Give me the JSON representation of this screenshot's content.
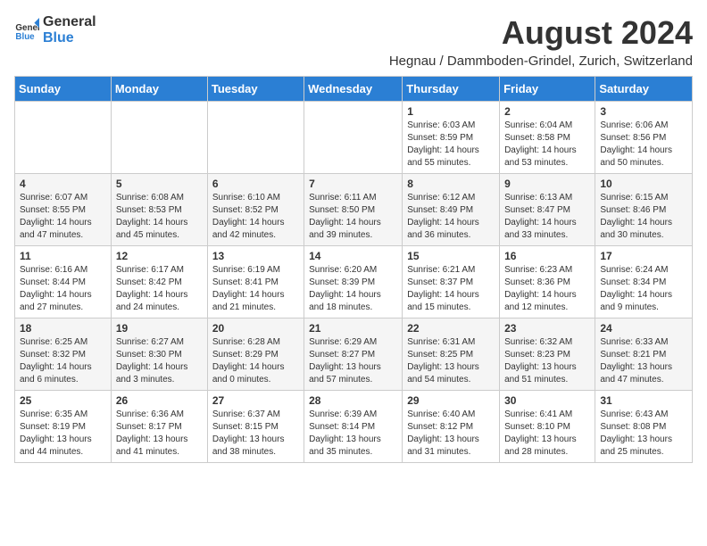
{
  "header": {
    "logo_general": "General",
    "logo_blue": "Blue",
    "month_year": "August 2024",
    "location": "Hegnau / Dammboden-Grindel, Zurich, Switzerland"
  },
  "weekdays": [
    "Sunday",
    "Monday",
    "Tuesday",
    "Wednesday",
    "Thursday",
    "Friday",
    "Saturday"
  ],
  "weeks": [
    [
      {
        "day": "",
        "info": ""
      },
      {
        "day": "",
        "info": ""
      },
      {
        "day": "",
        "info": ""
      },
      {
        "day": "",
        "info": ""
      },
      {
        "day": "1",
        "info": "Sunrise: 6:03 AM\nSunset: 8:59 PM\nDaylight: 14 hours\nand 55 minutes."
      },
      {
        "day": "2",
        "info": "Sunrise: 6:04 AM\nSunset: 8:58 PM\nDaylight: 14 hours\nand 53 minutes."
      },
      {
        "day": "3",
        "info": "Sunrise: 6:06 AM\nSunset: 8:56 PM\nDaylight: 14 hours\nand 50 minutes."
      }
    ],
    [
      {
        "day": "4",
        "info": "Sunrise: 6:07 AM\nSunset: 8:55 PM\nDaylight: 14 hours\nand 47 minutes."
      },
      {
        "day": "5",
        "info": "Sunrise: 6:08 AM\nSunset: 8:53 PM\nDaylight: 14 hours\nand 45 minutes."
      },
      {
        "day": "6",
        "info": "Sunrise: 6:10 AM\nSunset: 8:52 PM\nDaylight: 14 hours\nand 42 minutes."
      },
      {
        "day": "7",
        "info": "Sunrise: 6:11 AM\nSunset: 8:50 PM\nDaylight: 14 hours\nand 39 minutes."
      },
      {
        "day": "8",
        "info": "Sunrise: 6:12 AM\nSunset: 8:49 PM\nDaylight: 14 hours\nand 36 minutes."
      },
      {
        "day": "9",
        "info": "Sunrise: 6:13 AM\nSunset: 8:47 PM\nDaylight: 14 hours\nand 33 minutes."
      },
      {
        "day": "10",
        "info": "Sunrise: 6:15 AM\nSunset: 8:46 PM\nDaylight: 14 hours\nand 30 minutes."
      }
    ],
    [
      {
        "day": "11",
        "info": "Sunrise: 6:16 AM\nSunset: 8:44 PM\nDaylight: 14 hours\nand 27 minutes."
      },
      {
        "day": "12",
        "info": "Sunrise: 6:17 AM\nSunset: 8:42 PM\nDaylight: 14 hours\nand 24 minutes."
      },
      {
        "day": "13",
        "info": "Sunrise: 6:19 AM\nSunset: 8:41 PM\nDaylight: 14 hours\nand 21 minutes."
      },
      {
        "day": "14",
        "info": "Sunrise: 6:20 AM\nSunset: 8:39 PM\nDaylight: 14 hours\nand 18 minutes."
      },
      {
        "day": "15",
        "info": "Sunrise: 6:21 AM\nSunset: 8:37 PM\nDaylight: 14 hours\nand 15 minutes."
      },
      {
        "day": "16",
        "info": "Sunrise: 6:23 AM\nSunset: 8:36 PM\nDaylight: 14 hours\nand 12 minutes."
      },
      {
        "day": "17",
        "info": "Sunrise: 6:24 AM\nSunset: 8:34 PM\nDaylight: 14 hours\nand 9 minutes."
      }
    ],
    [
      {
        "day": "18",
        "info": "Sunrise: 6:25 AM\nSunset: 8:32 PM\nDaylight: 14 hours\nand 6 minutes."
      },
      {
        "day": "19",
        "info": "Sunrise: 6:27 AM\nSunset: 8:30 PM\nDaylight: 14 hours\nand 3 minutes."
      },
      {
        "day": "20",
        "info": "Sunrise: 6:28 AM\nSunset: 8:29 PM\nDaylight: 14 hours\nand 0 minutes."
      },
      {
        "day": "21",
        "info": "Sunrise: 6:29 AM\nSunset: 8:27 PM\nDaylight: 13 hours\nand 57 minutes."
      },
      {
        "day": "22",
        "info": "Sunrise: 6:31 AM\nSunset: 8:25 PM\nDaylight: 13 hours\nand 54 minutes."
      },
      {
        "day": "23",
        "info": "Sunrise: 6:32 AM\nSunset: 8:23 PM\nDaylight: 13 hours\nand 51 minutes."
      },
      {
        "day": "24",
        "info": "Sunrise: 6:33 AM\nSunset: 8:21 PM\nDaylight: 13 hours\nand 47 minutes."
      }
    ],
    [
      {
        "day": "25",
        "info": "Sunrise: 6:35 AM\nSunset: 8:19 PM\nDaylight: 13 hours\nand 44 minutes."
      },
      {
        "day": "26",
        "info": "Sunrise: 6:36 AM\nSunset: 8:17 PM\nDaylight: 13 hours\nand 41 minutes."
      },
      {
        "day": "27",
        "info": "Sunrise: 6:37 AM\nSunset: 8:15 PM\nDaylight: 13 hours\nand 38 minutes."
      },
      {
        "day": "28",
        "info": "Sunrise: 6:39 AM\nSunset: 8:14 PM\nDaylight: 13 hours\nand 35 minutes."
      },
      {
        "day": "29",
        "info": "Sunrise: 6:40 AM\nSunset: 8:12 PM\nDaylight: 13 hours\nand 31 minutes."
      },
      {
        "day": "30",
        "info": "Sunrise: 6:41 AM\nSunset: 8:10 PM\nDaylight: 13 hours\nand 28 minutes."
      },
      {
        "day": "31",
        "info": "Sunrise: 6:43 AM\nSunset: 8:08 PM\nDaylight: 13 hours\nand 25 minutes."
      }
    ]
  ]
}
